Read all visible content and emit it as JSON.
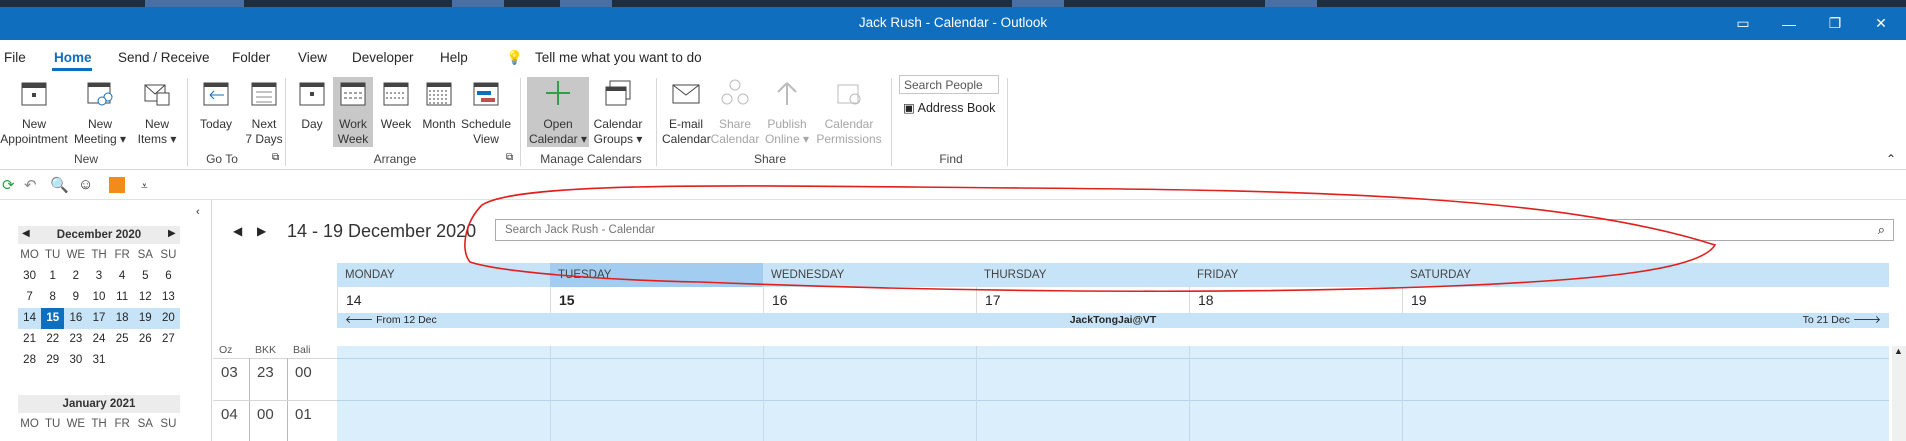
{
  "window": {
    "title": "Jack Rush - Calendar  -  Outlook"
  },
  "menu": {
    "items": [
      "File",
      "Home",
      "Send / Receive",
      "Folder",
      "View",
      "Developer",
      "Help"
    ],
    "tell_me": "Tell me what you want to do"
  },
  "ribbon": {
    "new_group": {
      "label": "New",
      "buttons": [
        {
          "line1": "New",
          "line2": "Appointment"
        },
        {
          "line1": "New",
          "line2": "Meeting ▾"
        },
        {
          "line1": "New",
          "line2": "Items ▾"
        }
      ]
    },
    "goto_group": {
      "label": "Go To",
      "buttons": [
        {
          "line1": "Today",
          "line2": ""
        },
        {
          "line1": "Next",
          "line2": "7 Days"
        }
      ]
    },
    "arrange_group": {
      "label": "Arrange",
      "buttons": [
        {
          "line1": "Day",
          "line2": ""
        },
        {
          "line1": "Work",
          "line2": "Week"
        },
        {
          "line1": "Week",
          "line2": ""
        },
        {
          "line1": "Month",
          "line2": ""
        },
        {
          "line1": "Schedule",
          "line2": "View"
        }
      ]
    },
    "manage_group": {
      "label": "Manage Calendars",
      "buttons": [
        {
          "line1": "Open",
          "line2": "Calendar ▾"
        },
        {
          "line1": "Calendar",
          "line2": "Groups ▾"
        }
      ]
    },
    "share_group": {
      "label": "Share",
      "buttons": [
        {
          "line1": "E-mail",
          "line2": "Calendar"
        },
        {
          "line1": "Share",
          "line2": "Calendar"
        },
        {
          "line1": "Publish",
          "line2": "Online ▾"
        },
        {
          "line1": "Calendar",
          "line2": "Permissions"
        }
      ]
    },
    "find_group": {
      "label": "Find",
      "search_people_placeholder": "Search People",
      "address_book": "Address Book"
    }
  },
  "mini_calendars": [
    {
      "title": "December 2020",
      "headers": [
        "MO",
        "TU",
        "WE",
        "TH",
        "FR",
        "SA",
        "SU"
      ],
      "weeks": [
        [
          "30",
          "1",
          "2",
          "3",
          "4",
          "5",
          "6"
        ],
        [
          "7",
          "8",
          "9",
          "10",
          "11",
          "12",
          "13"
        ],
        [
          "14",
          "15",
          "16",
          "17",
          "18",
          "19",
          "20"
        ],
        [
          "21",
          "22",
          "23",
          "24",
          "25",
          "26",
          "27"
        ],
        [
          "28",
          "29",
          "30",
          "31",
          "",
          "",
          ""
        ]
      ]
    },
    {
      "title": "January 2021",
      "headers": [
        "MO",
        "TU",
        "WE",
        "TH",
        "FR",
        "SA",
        "SU"
      ]
    }
  ],
  "calendar": {
    "range_title": "14 - 19 December 2020",
    "search_placeholder": "Search Jack Rush - Calendar",
    "days": [
      {
        "name": "MONDAY",
        "num": "14"
      },
      {
        "name": "TUESDAY",
        "num": "15"
      },
      {
        "name": "WEDNESDAY",
        "num": "16"
      },
      {
        "name": "THURSDAY",
        "num": "17"
      },
      {
        "name": "FRIDAY",
        "num": "18"
      },
      {
        "name": "SATURDAY",
        "num": "19"
      }
    ],
    "band": {
      "prev": "From 12 Dec",
      "center": "JackTongJai@VT",
      "next": "To 21 Dec"
    },
    "timezones": [
      {
        "label": "Oz",
        "hours": [
          "03",
          "04"
        ]
      },
      {
        "label": "BKK",
        "hours": [
          "23",
          "00"
        ]
      },
      {
        "label": "Bali",
        "hours": [
          "00",
          "01"
        ]
      }
    ]
  },
  "colors": {
    "brand": "#106ebe",
    "annotation": "#e0201c",
    "week_highlight": "#c7e3f7"
  }
}
